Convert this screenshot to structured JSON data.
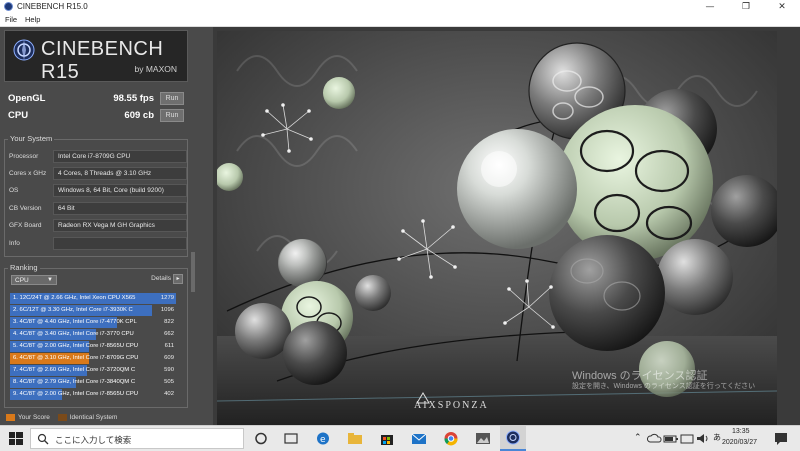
{
  "window": {
    "title": "CINEBENCH R15.0",
    "minimize": "—",
    "maximize": "❐",
    "close": "✕"
  },
  "menu": {
    "file": "File",
    "help": "Help"
  },
  "logo": {
    "name": "CINEBENCH R15",
    "by": "by MAXON"
  },
  "scores": {
    "opengl": {
      "label": "OpenGL",
      "value": "98.55 fps",
      "run": "Run"
    },
    "cpu": {
      "label": "CPU",
      "value": "609 cb",
      "run": "Run"
    }
  },
  "system": {
    "title": "Your System",
    "rows": [
      {
        "k": "Processor",
        "v": "Intel Core i7-8709G CPU"
      },
      {
        "k": "Cores x GHz",
        "v": "4 Cores, 8 Threads @ 3.10 GHz"
      },
      {
        "k": "OS",
        "v": "Windows 8, 64 Bit, Core (build 9200)"
      },
      {
        "k": "CB Version",
        "v": "64 Bit"
      },
      {
        "k": "GFX Board",
        "v": "Radeon RX Vega M GH Graphics"
      },
      {
        "k": "Info",
        "v": ""
      }
    ]
  },
  "ranking": {
    "title": "Ranking",
    "dropdown": "CPU",
    "details": "Details",
    "rows": [
      {
        "text": "1. 12C/24T @ 2.66 GHz, Intel Xeon CPU X565",
        "score": "1279",
        "fill": 1.0,
        "mine": false
      },
      {
        "text": "2. 6C/12T @ 3.30 GHz, Intel Core i7-3930K C",
        "score": "1096",
        "fill": 0.857,
        "mine": false
      },
      {
        "text": "3. 4C/8T @ 4.40 GHz, Intel Core i7-4770K CPL",
        "score": "822",
        "fill": 0.643,
        "mine": false
      },
      {
        "text": "4. 4C/8T @ 3.40 GHz, Intel Core i7-3770 CPU",
        "score": "662",
        "fill": 0.518,
        "mine": false
      },
      {
        "text": "5. 4C/8T @ 2.00 GHz, Intel Core i7-8565U CPU",
        "score": "611",
        "fill": 0.478,
        "mine": false
      },
      {
        "text": "6. 4C/8T @ 3.10 GHz, Intel Core i7-8709G CPU",
        "score": "609",
        "fill": 0.476,
        "mine": true
      },
      {
        "text": "7. 4C/8T @ 2.60 GHz, Intel Core i7-3720QM C",
        "score": "590",
        "fill": 0.461,
        "mine": false
      },
      {
        "text": "8. 4C/8T @ 2.79 GHz, Intel Core i7-3840QM C",
        "score": "505",
        "fill": 0.395,
        "mine": false
      },
      {
        "text": "9. 4C/8T @ 2.00 GHz, Intel Core i7-8565U CPU",
        "score": "402",
        "fill": 0.314,
        "mine": false
      }
    ]
  },
  "legend": {
    "your_score": "Your Score",
    "identical": "Identical System"
  },
  "render": {
    "watermark_line1": "Windows のライセンス認証",
    "watermark_line2": "設定を開き、Windows のライセンス認証を行ってください",
    "brand": "AIXSPONZA"
  },
  "taskbar": {
    "search_placeholder": "ここに入力して検索",
    "time": "13:35",
    "date": "2020/03/27",
    "ime": "あ"
  },
  "colors": {
    "bar": "#3d6fbf",
    "bar_mine": "#d9791a",
    "identical": "#7a4a1a",
    "panel": "#4a4a4a"
  }
}
